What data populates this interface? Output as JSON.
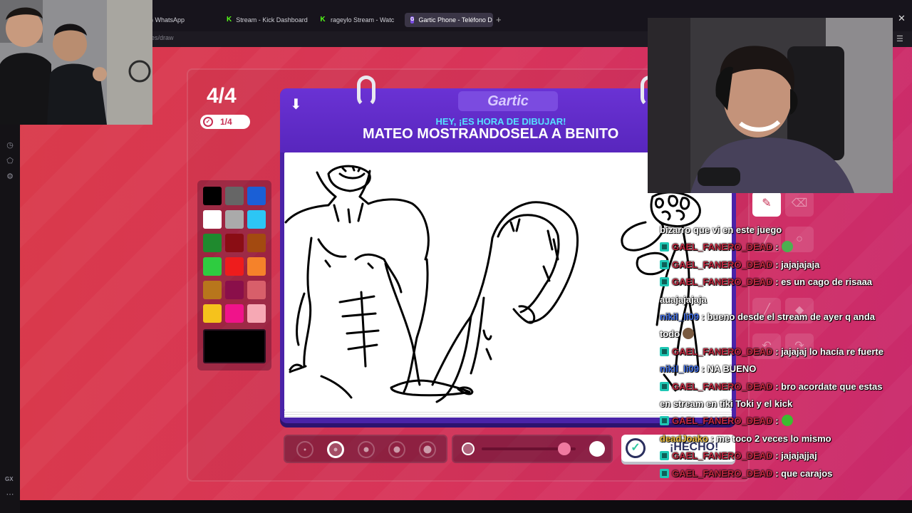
{
  "browser": {
    "tabs": [
      {
        "label": ") WhatsApp",
        "icon": "whatsapp-icon"
      },
      {
        "label": "Stream - Kick Dashboard",
        "icon": "kick-icon"
      },
      {
        "label": "rageylo Stream - Watc",
        "icon": "kick-icon"
      },
      {
        "label": "Gartic Phone - Teléfono D",
        "icon": "gartic-icon"
      }
    ],
    "new_tab": "+",
    "url": "es/draw",
    "close": "✕"
  },
  "sidebar": {
    "gx_label": "GX"
  },
  "game": {
    "round": "4/4",
    "progress": "1/4",
    "logo": "Gartic",
    "subtitle": "HEY, ¡ES HORA DE DIBUJAR!",
    "theme": "MATEO MOSTRANDOSELA A BENITO",
    "done_label": "¡HECHO!",
    "palette": [
      "#000000",
      "#666666",
      "#1a5fd6",
      "#ffffff",
      "#aaaaaa",
      "#2cc6f5",
      "#1f8a2e",
      "#8a0d14",
      "#a34a10",
      "#2ecc40",
      "#ee1c1c",
      "#f5822a",
      "#b8761c",
      "#8a0f4a",
      "#d85f6a",
      "#f5c21c",
      "#f0138a",
      "#f6a8b4"
    ],
    "current_color": "#000000",
    "brush_sizes": 5,
    "selected_brush": 2,
    "opacity_level": 0.88
  },
  "chat": [
    {
      "user": "",
      "text": "bizarro que vi en este juego",
      "color": "u1",
      "badge": false
    },
    {
      "user": "GAEL_FANERO_DEAD",
      "text": ":",
      "color": "u1",
      "badge": true,
      "emote": "#4caf50"
    },
    {
      "user": "GAEL_FANERO_DEAD",
      "text": ": jajajajaja",
      "color": "u1",
      "badge": true
    },
    {
      "user": "GAEL_FANERO_DEAD",
      "text": ": es un cago de risaaa",
      "color": "u1",
      "badge": true
    },
    {
      "user": "",
      "text": "auajajajaja",
      "color": "u1",
      "badge": false
    },
    {
      "user": "nikil_li09",
      "text": ": bueno desde el stream de ayer q anda",
      "color": "u2",
      "badge": false
    },
    {
      "user": "",
      "text": "todo",
      "color": "u2",
      "badge": false,
      "emote": "#7a5a40"
    },
    {
      "user": "GAEL_FANERO_DEAD",
      "text": ": jajajaj lo hacía re fuerte",
      "color": "u1",
      "badge": true
    },
    {
      "user": "nikil_li09",
      "text": ": NA BUENO",
      "color": "u2",
      "badge": false
    },
    {
      "user": "GAEL_FANERO_DEAD",
      "text": ": bro acordate que estas",
      "color": "u1",
      "badge": true
    },
    {
      "user": "",
      "text": "en stream en tiki Toki y el kick",
      "color": "u1",
      "badge": false
    },
    {
      "user": "GAEL_FANERO_DEAD",
      "text": ":",
      "color": "u1",
      "badge": true,
      "emote": "#3dbb2f"
    },
    {
      "user": "deadJoako",
      "text": ": me toco 2 veces lo mismo",
      "color": "u3",
      "badge": false
    },
    {
      "user": "GAEL_FANERO_DEAD",
      "text": ": jajajajjaj",
      "color": "u1",
      "badge": true
    },
    {
      "user": "GAEL_FANERO_DEAD",
      "text": ": que carajos",
      "color": "u1",
      "badge": true
    }
  ]
}
